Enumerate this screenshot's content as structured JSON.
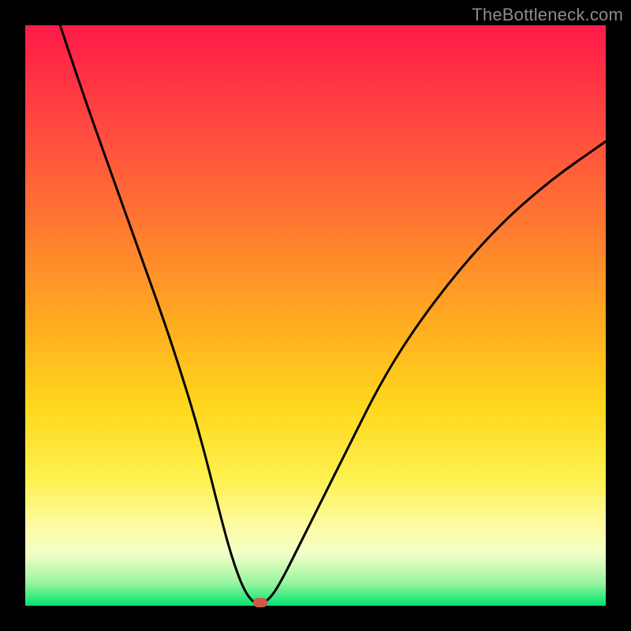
{
  "watermark": "TheBottleneck.com",
  "chart_data": {
    "type": "line",
    "title": "",
    "xlabel": "",
    "ylabel": "",
    "xlim": [
      0,
      100
    ],
    "ylim": [
      0,
      100
    ],
    "series": [
      {
        "name": "bottleneck-curve",
        "x": [
          6,
          10,
          15,
          20,
          25,
          30,
          34,
          36,
          38,
          40,
          42,
          44,
          48,
          55,
          62,
          70,
          80,
          90,
          100
        ],
        "values": [
          100,
          88,
          74,
          60,
          46,
          30,
          14,
          7,
          2,
          0,
          1,
          4,
          12,
          26,
          40,
          52,
          64,
          73,
          80
        ]
      }
    ],
    "marker": {
      "x": 40.5,
      "y": 0.6
    },
    "background_gradient": {
      "stops": [
        {
          "pos": 0,
          "color": "#ff1a48"
        },
        {
          "pos": 35,
          "color": "#ff7a30"
        },
        {
          "pos": 66,
          "color": "#ffd81e"
        },
        {
          "pos": 91,
          "color": "#f3ffc8"
        },
        {
          "pos": 100,
          "color": "#00e36e"
        }
      ]
    }
  }
}
